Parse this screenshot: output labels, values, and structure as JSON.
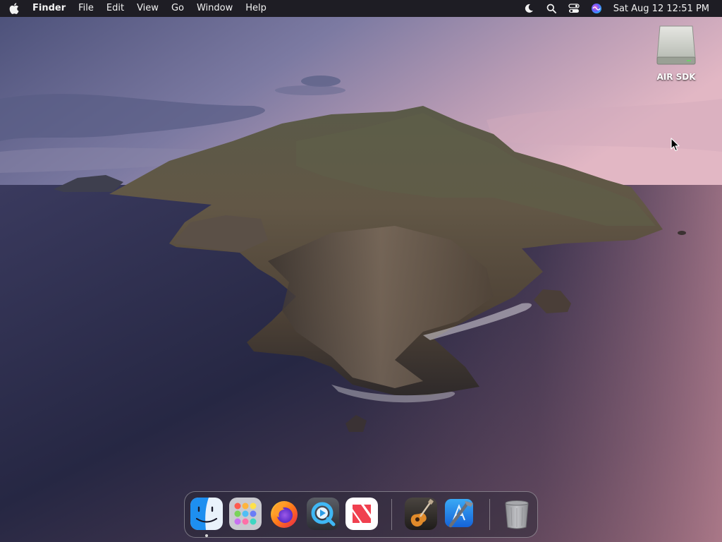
{
  "menubar": {
    "app_name": "Finder",
    "menus": [
      "File",
      "Edit",
      "View",
      "Go",
      "Window",
      "Help"
    ],
    "status_icons": [
      "moon-icon",
      "search-icon",
      "control-center-icon",
      "siri-icon"
    ],
    "clock": "Sat Aug 12  12:51 PM"
  },
  "desktop": {
    "icons": [
      {
        "label": "AIR SDK",
        "icon": "external-drive-icon"
      }
    ]
  },
  "dock": {
    "items": [
      {
        "name": "Finder",
        "icon": "finder-icon",
        "running": true
      },
      {
        "name": "Launchpad",
        "icon": "launchpad-icon",
        "running": false
      },
      {
        "name": "Firefox",
        "icon": "firefox-icon",
        "running": false
      },
      {
        "name": "QuickTime Player",
        "icon": "quicktime-icon",
        "running": false
      },
      {
        "name": "News",
        "icon": "news-icon",
        "running": false
      },
      {
        "name": "GarageBand",
        "icon": "garageband-icon",
        "running": false
      },
      {
        "name": "Xcode",
        "icon": "xcode-icon",
        "running": false
      },
      {
        "name": "Trash",
        "icon": "trash-icon",
        "running": false
      }
    ]
  },
  "colors": {
    "menubar_bg": "#1e1d24",
    "finder_blue": "#1e8ff0",
    "news_red": "#f0404f"
  }
}
